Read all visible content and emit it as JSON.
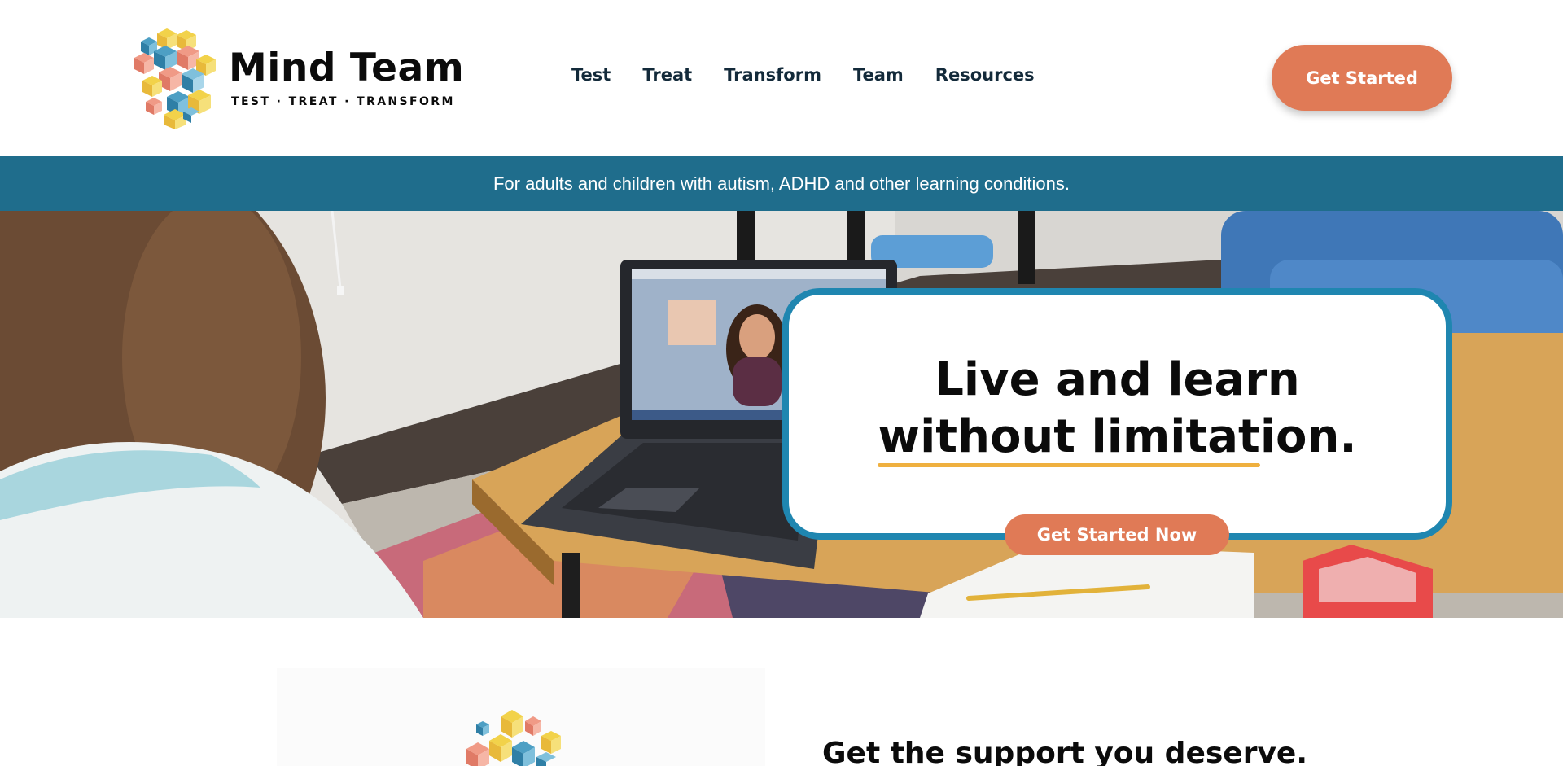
{
  "brand": {
    "name": "Mind Team",
    "tagline": "TEST · TREAT · TRANSFORM"
  },
  "nav": {
    "items": [
      {
        "label": "Test"
      },
      {
        "label": "Treat"
      },
      {
        "label": "Transform"
      },
      {
        "label": "Team"
      },
      {
        "label": "Resources"
      }
    ]
  },
  "header": {
    "cta_label": "Get Started"
  },
  "announcement": {
    "text": "For adults and children with autism, ADHD and other learning conditions."
  },
  "hero": {
    "headline_line1": "Live and learn",
    "headline_line2": "without limitation.",
    "cta_label": "Get Started Now"
  },
  "section": {
    "heading": "Get the support you deserve."
  },
  "icons": {
    "logo": "cube-head-logo-icon",
    "section_logo": "cube-cluster-logo-icon"
  },
  "colors": {
    "accent": "#e07a56",
    "banner": "#1f6d8c",
    "card_border": "#1f86b0",
    "underline": "#efb03f",
    "text": "#0b0b0b"
  }
}
